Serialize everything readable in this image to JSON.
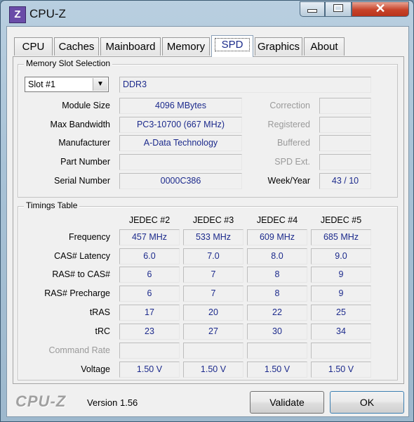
{
  "window": {
    "title": "CPU-Z",
    "icon_letter": "Z",
    "close_glyph": "✕"
  },
  "tabs": [
    "CPU",
    "Caches",
    "Mainboard",
    "Memory",
    "SPD",
    "Graphics",
    "About"
  ],
  "active_tab": "SPD",
  "memory_slot": {
    "legend": "Memory Slot Selection",
    "slot_selected": "Slot #1",
    "type": "DDR3",
    "rows": [
      {
        "label": "Module Size",
        "value": "4096 MBytes",
        "right_label": "Correction",
        "right_value": ""
      },
      {
        "label": "Max Bandwidth",
        "value": "PC3-10700 (667 MHz)",
        "right_label": "Registered",
        "right_value": ""
      },
      {
        "label": "Manufacturer",
        "value": "A-Data Technology",
        "right_label": "Buffered",
        "right_value": ""
      },
      {
        "label": "Part Number",
        "value": "",
        "right_label": "SPD Ext.",
        "right_value": ""
      },
      {
        "label": "Serial Number",
        "value": "0000C386",
        "right_label": "Week/Year",
        "right_value": "43 / 10"
      }
    ]
  },
  "timings": {
    "legend": "Timings Table",
    "columns": [
      "JEDEC #2",
      "JEDEC #3",
      "JEDEC #4",
      "JEDEC #5"
    ],
    "rows": [
      {
        "label": "Frequency",
        "values": [
          "457 MHz",
          "533 MHz",
          "609 MHz",
          "685 MHz"
        ]
      },
      {
        "label": "CAS# Latency",
        "values": [
          "6.0",
          "7.0",
          "8.0",
          "9.0"
        ]
      },
      {
        "label": "RAS# to CAS#",
        "values": [
          "6",
          "7",
          "8",
          "9"
        ]
      },
      {
        "label": "RAS# Precharge",
        "values": [
          "6",
          "7",
          "8",
          "9"
        ]
      },
      {
        "label": "tRAS",
        "values": [
          "17",
          "20",
          "22",
          "25"
        ]
      },
      {
        "label": "tRC",
        "values": [
          "23",
          "27",
          "30",
          "34"
        ]
      },
      {
        "label": "Command Rate",
        "values": [
          "",
          "",
          "",
          ""
        ]
      },
      {
        "label": "Voltage",
        "values": [
          "1.50 V",
          "1.50 V",
          "1.50 V",
          "1.50 V"
        ]
      }
    ]
  },
  "footer": {
    "logo": "CPU-Z",
    "version": "Version 1.56",
    "validate_label": "Validate",
    "ok_label": "OK"
  },
  "colors": {
    "value_text": "#1c2a8c",
    "disabled_text": "#9a9a9a",
    "close_button": "#c7432a"
  }
}
